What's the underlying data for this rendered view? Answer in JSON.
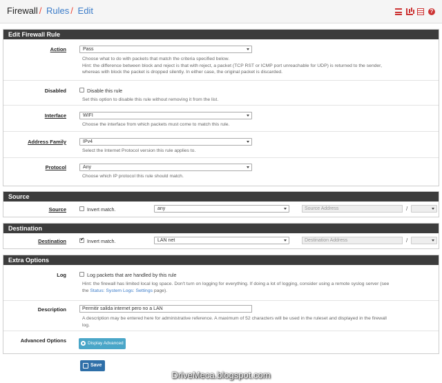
{
  "breadcrumb": [
    "Firewall",
    "Rules",
    "Edit"
  ],
  "breadcrumb_sep": "/",
  "header_icons": [
    "sliders-icon",
    "bar-chart-icon",
    "list-icon",
    "help-icon"
  ],
  "accent": "#cc3333",
  "sections": {
    "edit": "Edit Firewall Rule",
    "source": "Source",
    "destination": "Destination",
    "extra": "Extra Options"
  },
  "action": {
    "label": "Action",
    "value": "Pass",
    "help1": "Choose what to do with packets that match the criteria specified below.",
    "help2": "Hint: the difference between block and reject is that with reject, a packet (TCP RST or ICMP port unreachable for UDP) is returned to the sender,",
    "help3": "whereas with block the packet is dropped silently. In either case, the original packet is discarded."
  },
  "disabled": {
    "label": "Disabled",
    "checkbox": "Disable this rule",
    "help": "Set this option to disable this rule without removing it from the list."
  },
  "interface": {
    "label": "Interface",
    "value": "WIFI",
    "help": "Choose the interface from which packets must come to match this rule."
  },
  "address_family": {
    "label": "Address Family",
    "value": "IPv4",
    "help": "Select the Internet Protocol version this rule applies to."
  },
  "protocol": {
    "label": "Protocol",
    "value": "Any",
    "help": "Choose which IP protocol this rule should match."
  },
  "source": {
    "label": "Source",
    "invert": "Invert match.",
    "type": "any",
    "address_placeholder": "Source Address",
    "slash": "/"
  },
  "destination": {
    "label": "Destination",
    "invert": "Invert match.",
    "type": "LAN net",
    "address_placeholder": "Destination Address",
    "slash": "/"
  },
  "log": {
    "label": "Log",
    "checkbox": "Log packets that are handled by this rule",
    "help1": "Hint: the firewall has limited local log space. Don't turn on logging for everything. If doing a lot of logging, consider using a remote syslog server (see",
    "help2_pre": "the ",
    "help2_link": "Status: System Logs: Settings",
    "help2_post": " page)."
  },
  "description": {
    "label": "Description",
    "value": "Permitir salida internet pero no a LAN",
    "help1": "A description may be entered here for administrative reference. A maximum of 52 characters will be used in the ruleset and displayed in the firewall",
    "help2": "log."
  },
  "advanced": {
    "label": "Advanced Options",
    "button": "Display Advanced"
  },
  "save_button": "Save",
  "watermark": "DriveMeca.blogspot.com"
}
